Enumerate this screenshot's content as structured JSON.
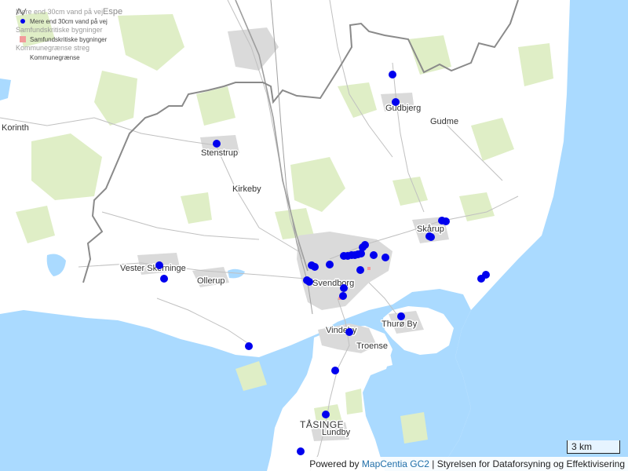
{
  "legend": {
    "layers": [
      {
        "title": "Mere end 30cm vand på vej",
        "item": "Mere end 30cm vand på vej",
        "symbol": "blue-dot-icon"
      },
      {
        "title": "Samfundskritiske bygninger",
        "item": "Samfundskritiske bygninger",
        "symbol": "red-square-icon"
      },
      {
        "title": "Kommunegrænse streg",
        "item": "Kommunegrænse",
        "symbol": "boundary-line-icon"
      }
    ]
  },
  "places": [
    {
      "name": "Espe"
    },
    {
      "name": "Gudbjerg"
    },
    {
      "name": "Gudme"
    },
    {
      "name": "Korinth"
    },
    {
      "name": "Stenstrup"
    },
    {
      "name": "Kirkeby"
    },
    {
      "name": "Skårup"
    },
    {
      "name": "Vester Skerninge"
    },
    {
      "name": "Ollerup"
    },
    {
      "name": "Svendborg"
    },
    {
      "name": "Thurø By"
    },
    {
      "name": "Vindeby"
    },
    {
      "name": "Troense"
    },
    {
      "name": "TÅSINGE"
    },
    {
      "name": "Lundby"
    }
  ],
  "flood_points_count": 38,
  "colors": {
    "water": "#aadaff",
    "land": "#ffffff",
    "forest": "#dfeec6",
    "urban": "#dadada",
    "point": "#0000ee",
    "boundary": "#888888",
    "building": "#f29b9b"
  },
  "scale": {
    "label": "3 km"
  },
  "attribution": {
    "prefix": "Powered by",
    "link": "MapCentia GC2",
    "separator": "|",
    "source": "Styrelsen for Dataforsyning og Effektivisering"
  }
}
